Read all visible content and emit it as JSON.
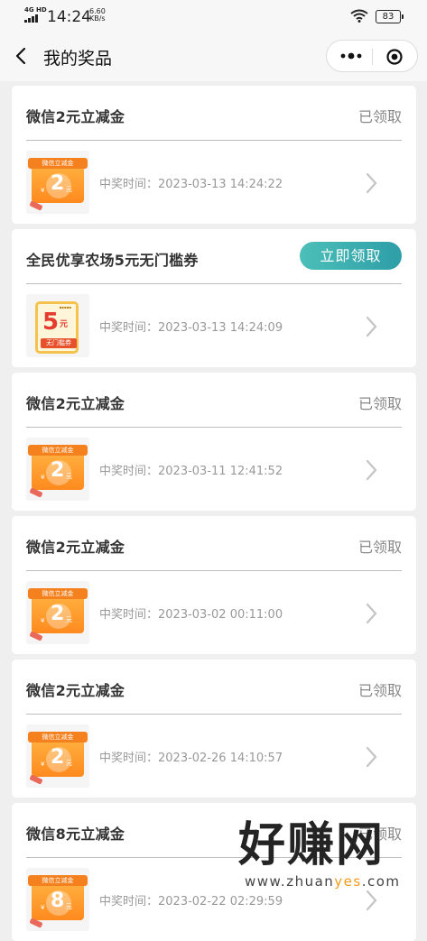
{
  "status_bar": {
    "network": "4G HD",
    "time": "14:24",
    "speed_value": "6.60",
    "speed_unit": "KB/s",
    "battery": "83"
  },
  "nav": {
    "title": "我的奖品",
    "back_icon": "chevron-left-icon",
    "more_icon": "more-dots-icon",
    "close_icon": "target-circle-icon"
  },
  "prizes": [
    {
      "title": "微信2元立减金",
      "status": "已领取",
      "time_label": "中奖时间：",
      "time": "2023-03-13 14:24:22",
      "coupon_amount": "2",
      "coupon_header": "微信立减金",
      "coupon_unit": "元",
      "coupon_sign": "¥"
    },
    {
      "title": "全民优享农场5元无门槛券",
      "action": "立即领取",
      "time_label": "中奖时间：",
      "time": "2023-03-13 14:24:09",
      "ticket_amount": "5",
      "ticket_unit": "元",
      "ticket_label": "无门槛券"
    },
    {
      "title": "微信2元立减金",
      "status": "已领取",
      "time_label": "中奖时间：",
      "time": "2023-03-11 12:41:52",
      "coupon_amount": "2",
      "coupon_header": "微信立减金",
      "coupon_unit": "元",
      "coupon_sign": "¥"
    },
    {
      "title": "微信2元立减金",
      "status": "已领取",
      "time_label": "中奖时间：",
      "time": "2023-03-02 00:11:00",
      "coupon_amount": "2",
      "coupon_header": "微信立减金",
      "coupon_unit": "元",
      "coupon_sign": "¥"
    },
    {
      "title": "微信2元立减金",
      "status": "已领取",
      "time_label": "中奖时间：",
      "time": "2023-02-26 14:10:57",
      "coupon_amount": "2",
      "coupon_header": "微信立减金",
      "coupon_unit": "元",
      "coupon_sign": "¥"
    },
    {
      "title": "微信8元立减金",
      "status": "已领取",
      "time_label": "中奖时间：",
      "time": "2023-02-22 02:29:59",
      "coupon_amount": "8",
      "coupon_header": "微信立减金",
      "coupon_unit": "元",
      "coupon_sign": "¥"
    }
  ],
  "watermark": {
    "text": "好赚网",
    "url_prefix": "www.zhuan",
    "url_highlight": "yes",
    "url_suffix": ".com"
  },
  "colors": {
    "accent_button": "#2e9ea7",
    "coupon_orange": "#ff8a1e",
    "ticket_red": "#e43d2f"
  }
}
